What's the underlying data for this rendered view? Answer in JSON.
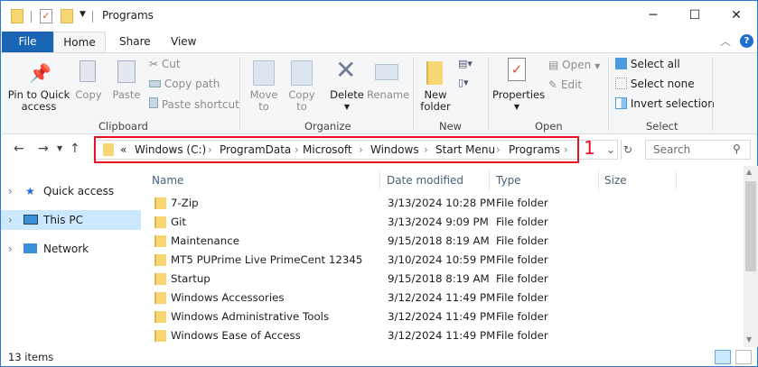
{
  "window": {
    "title": "Programs",
    "minimize": "─",
    "maximize": "☐",
    "close": "✕"
  },
  "tabs": [
    "File",
    "Home",
    "Share",
    "View"
  ],
  "ribbon": {
    "clipboard": {
      "label": "Clipboard",
      "pin": "Pin to Quick access",
      "pin_l1": "Pin to Quick",
      "pin_l2": "access",
      "copy": "Copy",
      "paste": "Paste",
      "cut": "Cut",
      "copy_path": "Copy path",
      "paste_shortcut": "Paste shortcut"
    },
    "organize": {
      "label": "Organize",
      "move_l1": "Move",
      "move_l2": "to",
      "copy_l1": "Copy",
      "copy_l2": "to",
      "delete": "Delete",
      "rename": "Rename"
    },
    "new": {
      "label": "New",
      "new_l1": "New",
      "new_l2": "folder"
    },
    "open": {
      "label": "Open",
      "properties": "Properties",
      "open": "Open",
      "edit": "Edit"
    },
    "select": {
      "label": "Select",
      "select_all": "Select all",
      "select_none": "Select none",
      "invert": "Invert selection"
    }
  },
  "address": {
    "overflow": "«",
    "crumbs": [
      "Windows (C:)",
      "ProgramData",
      "Microsoft",
      "Windows",
      "Start Menu",
      "Programs"
    ],
    "annotation": "1",
    "search_placeholder": "Search",
    "annotation_color": "#e81123"
  },
  "nav": [
    {
      "label": "Quick access",
      "icon": "star-icon"
    },
    {
      "label": "This PC",
      "icon": "computer-icon",
      "selected": true
    },
    {
      "label": "Network",
      "icon": "network-icon"
    }
  ],
  "columns": [
    "Name",
    "Date modified",
    "Type",
    "Size"
  ],
  "files": [
    {
      "name": "7-Zip",
      "date": "3/13/2024 10:28 PM",
      "type": "File folder"
    },
    {
      "name": "Git",
      "date": "3/13/2024 9:09 PM",
      "type": "File folder"
    },
    {
      "name": "Maintenance",
      "date": "9/15/2018 8:19 AM",
      "type": "File folder"
    },
    {
      "name": "MT5 PUPrime Live PrimeCent 12345",
      "date": "3/10/2024 10:59 PM",
      "type": "File folder"
    },
    {
      "name": "Startup",
      "date": "9/15/2018 8:19 AM",
      "type": "File folder"
    },
    {
      "name": "Windows Accessories",
      "date": "3/12/2024 11:49 PM",
      "type": "File folder"
    },
    {
      "name": "Windows Administrative Tools",
      "date": "3/12/2024 11:49 PM",
      "type": "File folder"
    },
    {
      "name": "Windows Ease of Access",
      "date": "3/12/2024 11:49 PM",
      "type": "File folder"
    }
  ],
  "status": {
    "count": "13 items"
  }
}
